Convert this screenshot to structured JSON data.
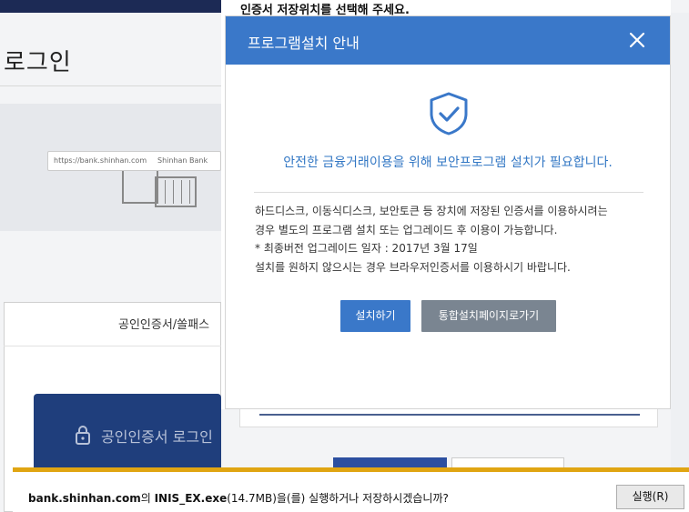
{
  "background": {
    "login_title": "로그인",
    "banner_url": "https://bank.shinhan.com",
    "banner_site": "Shinhan Bank",
    "card_tab": "공인인증서/쏠패스",
    "cert_button": "공인인증서 로그인",
    "caption": "인증서 저장위치를 선택해 주세요."
  },
  "modal": {
    "title": "프로그램설치 안내",
    "close_icon": "close-icon",
    "status_icon": "shield-check-icon",
    "headline": "안전한 금융거래이용을 위해 보안프로그램 설치가 필요합니다.",
    "body_lines": [
      "하드디스크, 이동식디스크, 보안토큰 등 장치에 저장된 인증서를 이용하시려는",
      "경우 별도의 프로그램 설치 또는 업그레이드 후 이용이 가능합니다.",
      "* 최종버전 업그레이드 일자 : 2017년 3월 17일",
      "설치를 원하지 않으시는 경우 브라우저인증서를 이용하시기 바랍니다."
    ],
    "install_button": "설치하기",
    "integrated_button": "통합설치페이지로가기"
  },
  "download_bar": {
    "domain": "bank.shinhan.com",
    "text_1": "의 ",
    "filename": "INIS_EX.exe",
    "size": "(14.7MB)",
    "text_2": "을(를) 실행하거나 저장하시겠습니까?",
    "run_button": "실행(R)"
  },
  "colors": {
    "accent": "#3a78c9",
    "secondary_button": "#7a8591",
    "download_bar_accent": "#e0a512"
  }
}
